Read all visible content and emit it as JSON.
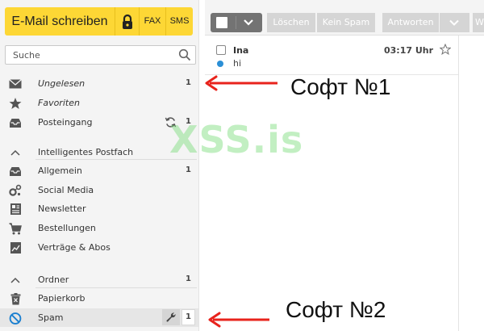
{
  "compose": {
    "label": "E-Mail schreiben",
    "fax": "FAX",
    "sms": "SMS"
  },
  "search": {
    "placeholder": "Suche"
  },
  "folders": {
    "unread": {
      "label": "Ungelesen",
      "count": "1"
    },
    "favorites": {
      "label": "Favoriten"
    },
    "inbox": {
      "label": "Posteingang",
      "count": "1"
    },
    "smart_section": {
      "label": "Intelligentes Postfach"
    },
    "general": {
      "label": "Allgemein",
      "count": "1"
    },
    "social": {
      "label": "Social Media"
    },
    "newsletter": {
      "label": "Newsletter"
    },
    "orders": {
      "label": "Bestellungen"
    },
    "contracts": {
      "label": "Verträge & Abos"
    },
    "folder_section": {
      "label": "Ordner",
      "count": "1"
    },
    "trash": {
      "label": "Papierkorb"
    },
    "spam": {
      "label": "Spam",
      "count": "1"
    }
  },
  "toolbar": {
    "delete": "Löschen",
    "not_spam": "Kein Spam",
    "reply": "Antworten",
    "more_initial": "W"
  },
  "mail": {
    "sender": "Ina",
    "time": "03:17 Uhr",
    "subject": "hi"
  },
  "annotations": {
    "first": "Софт №1",
    "second": "Софт №2",
    "watermark": "XSS.is"
  },
  "colors": {
    "accent_yellow": "#fdd735",
    "arrow_red": "#e8231c",
    "unread_dot": "#2b8fd6",
    "watermark_green": "#7ddc7d"
  }
}
